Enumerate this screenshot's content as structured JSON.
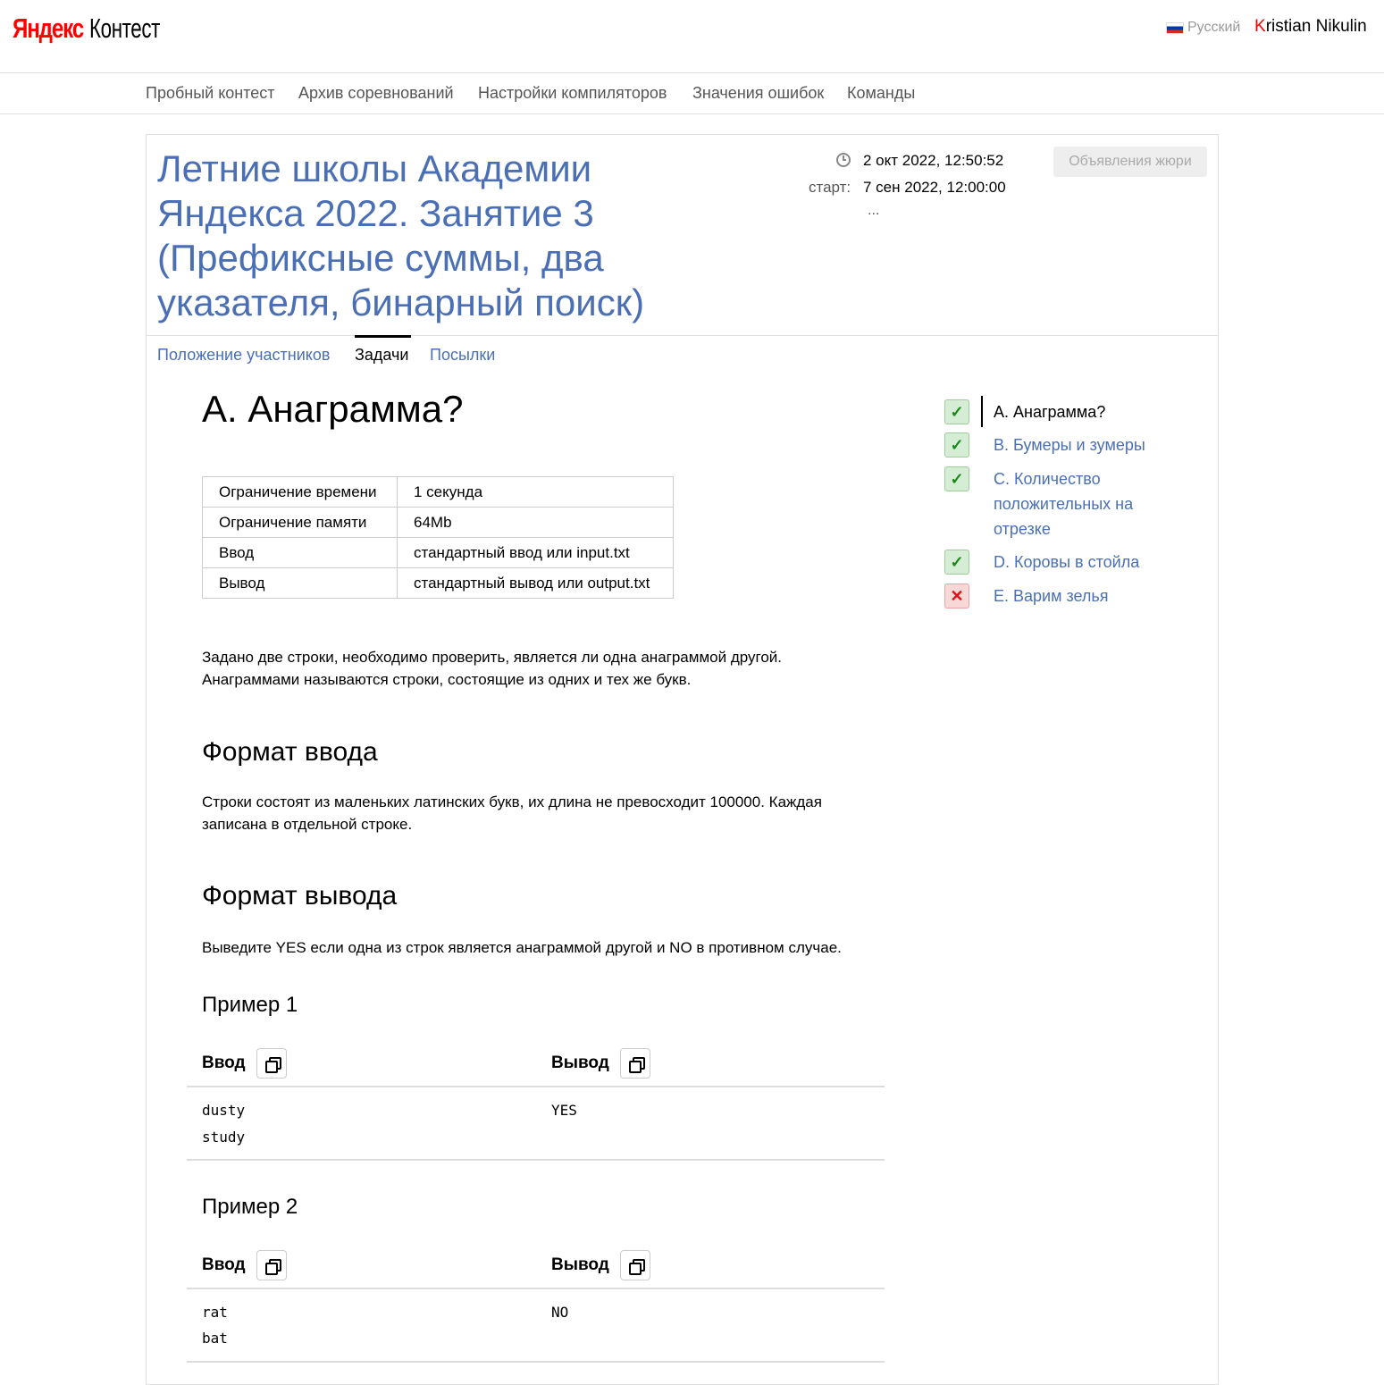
{
  "header": {
    "logo_yandex": "Яндекс",
    "logo_contest": "Контест",
    "language": "Русский",
    "user_first_letter": "K",
    "user_rest": "ristian Nikulin"
  },
  "nav": [
    "Пробный контест",
    "Архив соревнований",
    "Настройки компиляторов",
    "Значения ошибок",
    "Команды"
  ],
  "contest": {
    "title": "Летние школы Академии Яндекса 2022. Занятие 3 (Префиксные суммы, два указателя, бинарный поиск)",
    "current_time": "2 окт 2022, 12:50:52",
    "start_label": "старт:",
    "start_time": "7 сен 2022, 12:00:00",
    "more": "...",
    "announcements_button": "Объявления жюри"
  },
  "tabs": [
    "Положение участников",
    "Задачи",
    "Посылки"
  ],
  "problem": {
    "title": "A. Анаграмма?",
    "limits": [
      [
        "Ограничение времени",
        "1 секунда"
      ],
      [
        "Ограничение памяти",
        "64Mb"
      ],
      [
        "Ввод",
        "стандартный ввод или input.txt"
      ],
      [
        "Вывод",
        "стандартный вывод или output.txt"
      ]
    ],
    "statement_1": "Задано две строки, необходимо проверить, является ли одна анаграммой другой.",
    "statement_2": "Анаграммами называются строки, состоящие из одних и тех же букв.",
    "input_heading": "Формат ввода",
    "input_text_1": "Строки состоят из маленьких латинских букв, их длина не превосходит 100000. Каждая",
    "input_text_2": "записана в отдельной строке.",
    "output_heading": "Формат вывода",
    "output_text": "Выведите YES если одна из строк является анаграммой другой и NO в противном случае.",
    "examples": [
      {
        "title": "Пример 1",
        "input_label": "Ввод",
        "output_label": "Вывод",
        "input_1": "dusty",
        "input_2": "study",
        "output": "YES"
      },
      {
        "title": "Пример 2",
        "input_label": "Ввод",
        "output_label": "Вывод",
        "input_1": "rat",
        "input_2": "bat",
        "output": "NO"
      }
    ]
  },
  "sidebar": {
    "items": [
      {
        "label": "A. Анаграмма?",
        "status": "ok",
        "icon": "check-icon",
        "current": true
      },
      {
        "label": "B. Бумеры и зумеры",
        "status": "ok",
        "icon": "check-icon"
      },
      {
        "label_1": "C. Количество",
        "label_2": "положительных на",
        "label_3": "отрезке",
        "status": "ok",
        "icon": "check-icon"
      },
      {
        "label": "D. Коровы в стойла",
        "status": "ok",
        "icon": "check-icon"
      },
      {
        "label": "E. Варим зелья",
        "status": "fail",
        "icon": "cross-icon"
      }
    ]
  },
  "colors": {
    "link": "#4a6fb5",
    "accent": "#ff0000",
    "ok": "#1b8a1b",
    "fail": "#dd1111"
  }
}
